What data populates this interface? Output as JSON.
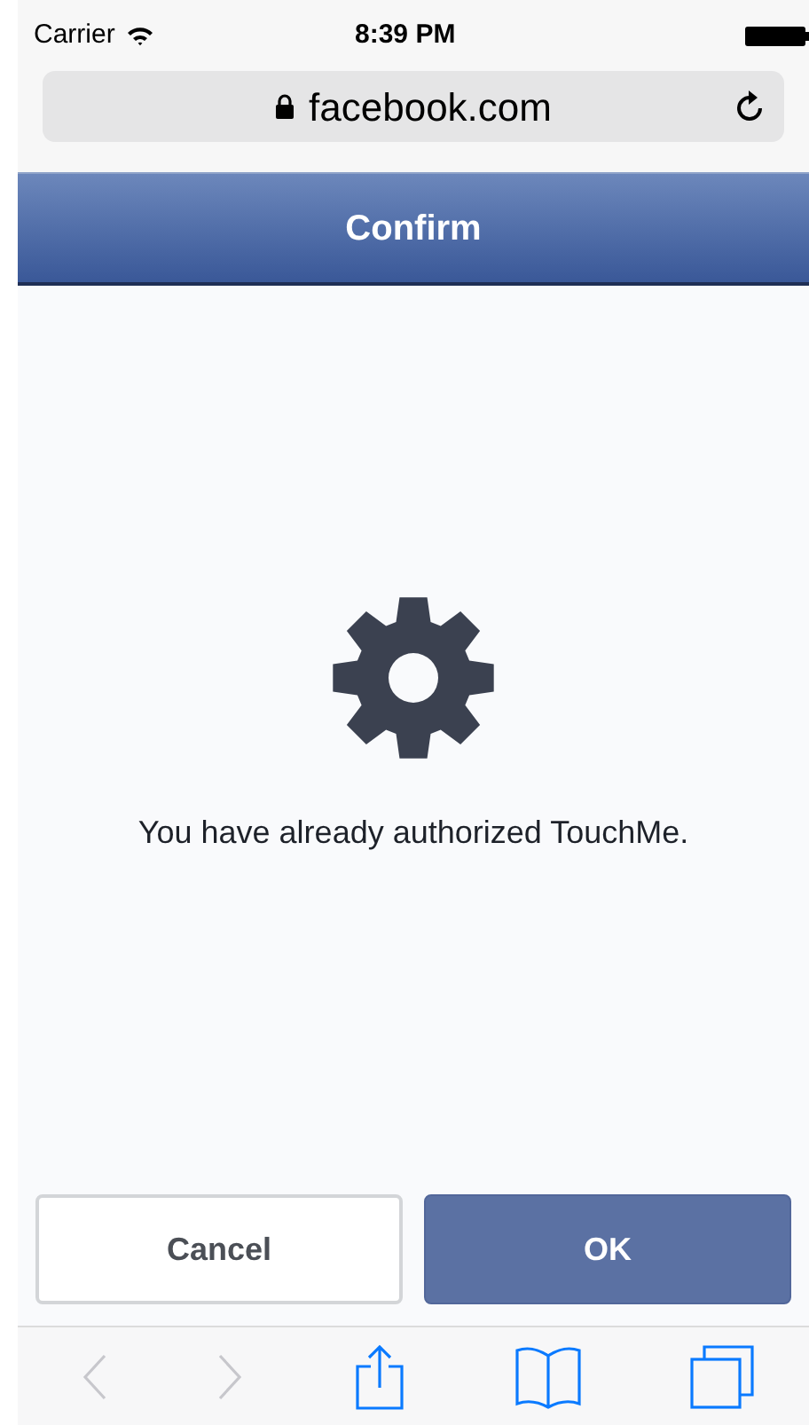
{
  "status_bar": {
    "carrier": "Carrier",
    "time": "8:39 PM"
  },
  "address_bar": {
    "url": "facebook.com",
    "secure": true
  },
  "header": {
    "title": "Confirm"
  },
  "message": "You have already authorized TouchMe.",
  "buttons": [
    {
      "label": "Cancel",
      "kind": "secondary"
    },
    {
      "label": "OK",
      "kind": "primary"
    }
  ],
  "toolbar": [
    {
      "kind": "back",
      "disabled": true
    },
    {
      "kind": "forward",
      "disabled": true
    },
    {
      "kind": "share",
      "disabled": false
    },
    {
      "kind": "bookmarks",
      "disabled": false
    },
    {
      "kind": "tabs",
      "disabled": false
    }
  ]
}
